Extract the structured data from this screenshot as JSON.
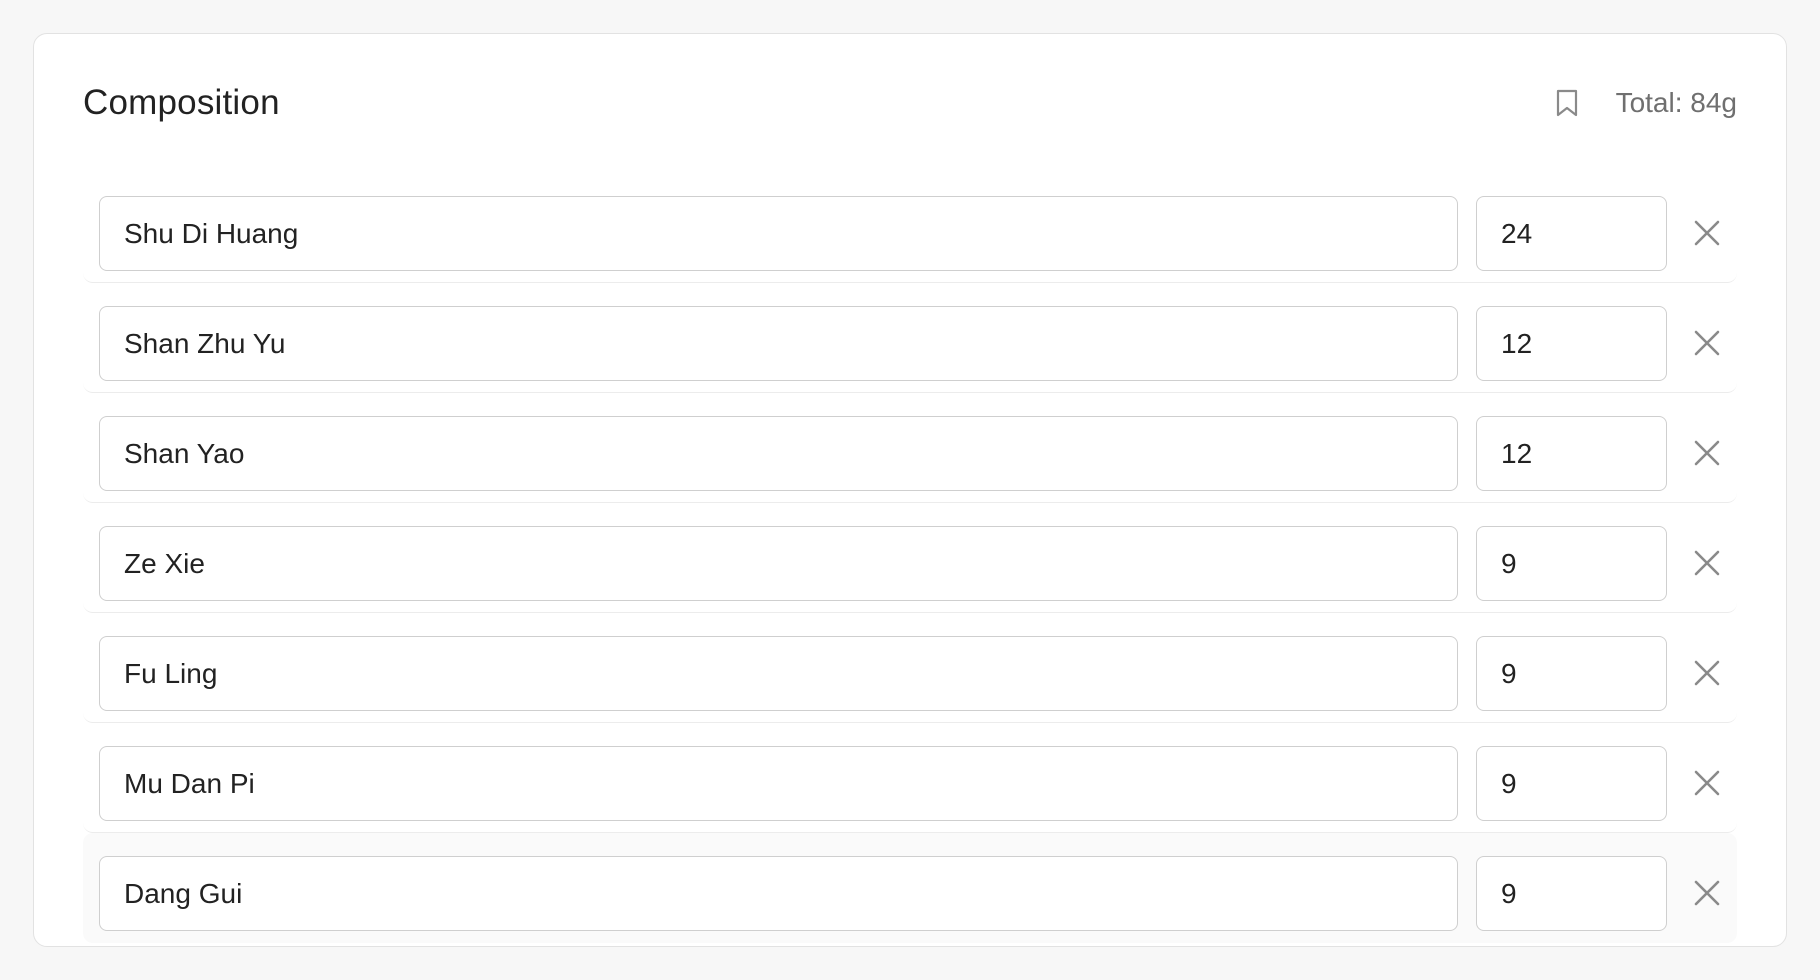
{
  "composition": {
    "title": "Composition",
    "total_label": "Total: 84g",
    "icons": {
      "bookmark": "bookmark-icon",
      "remove": "close-icon"
    },
    "colors": {
      "border": "#cfcfcf",
      "muted_text": "#6f6f6f",
      "icon": "#8a8a8a"
    },
    "ingredients": [
      {
        "name": "Shu Di Huang",
        "qty": "24"
      },
      {
        "name": "Shan Zhu Yu",
        "qty": "12"
      },
      {
        "name": "Shan Yao",
        "qty": "12"
      },
      {
        "name": "Ze Xie",
        "qty": "9"
      },
      {
        "name": "Fu Ling",
        "qty": "9"
      },
      {
        "name": "Mu Dan Pi",
        "qty": "9"
      },
      {
        "name": "Dang Gui",
        "qty": "9"
      }
    ]
  }
}
